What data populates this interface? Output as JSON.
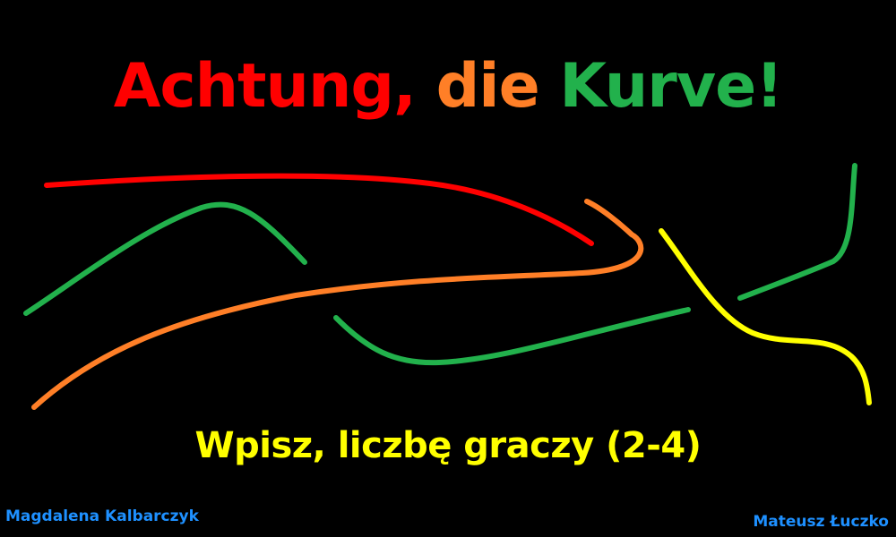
{
  "title": {
    "word1": "Achtung,",
    "word2": "die",
    "word3": "Kurve!",
    "color1": "#ff0000",
    "color2": "#ff7f27",
    "color3": "#22b14c"
  },
  "prompt": {
    "text": "Wpisz, liczbę graczy (2-4)",
    "color": "#ffff00"
  },
  "credits": {
    "left": "Magdalena Kalbarczyk",
    "right": "Mateusz Łuczko",
    "color": "#1e90ff"
  },
  "curves": [
    {
      "player": "red",
      "color": "#ff0000"
    },
    {
      "player": "green",
      "color": "#22b14c"
    },
    {
      "player": "orange",
      "color": "#ff7f27"
    },
    {
      "player": "yellow",
      "color": "#ffff00"
    }
  ]
}
